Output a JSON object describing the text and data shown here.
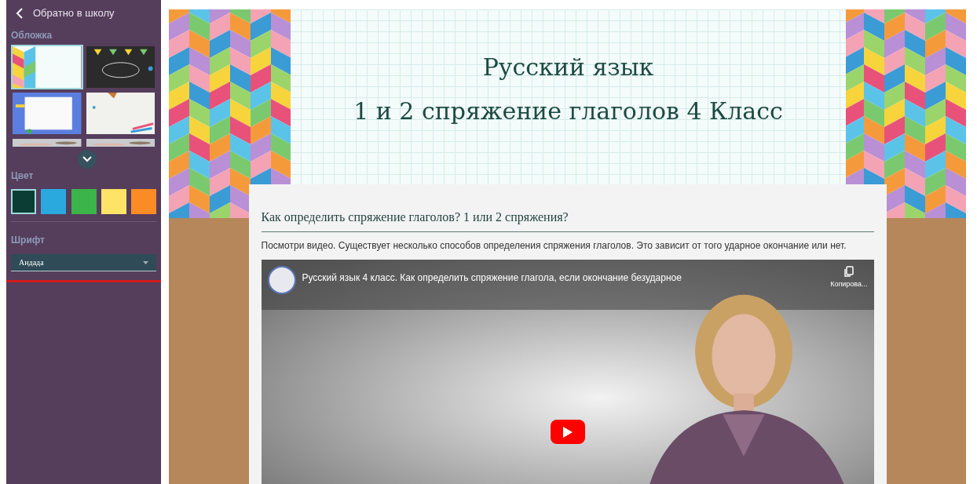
{
  "sidebar": {
    "back_link": "Обратно в школу",
    "cover_section": {
      "title": "Обложка",
      "covers": [
        {
          "selected": true
        },
        {
          "selected": false
        },
        {
          "selected": false
        },
        {
          "selected": false
        },
        {
          "selected": false
        },
        {
          "selected": false
        }
      ]
    },
    "color_section": {
      "title": "Цвет",
      "swatches": [
        {
          "color": "#0b3d35",
          "selected": true
        },
        {
          "color": "#29a9de",
          "selected": false
        },
        {
          "color": "#3bb449",
          "selected": false
        },
        {
          "color": "#fde466",
          "selected": false
        },
        {
          "color": "#fb8b24",
          "selected": false
        }
      ]
    },
    "font_section": {
      "title": "Шрифт",
      "value": "Андада"
    }
  },
  "page": {
    "title_lines": [
      "Русский язык",
      "1 и 2 спряжение глаголов 4 Класс"
    ],
    "card": {
      "heading": "Как определить спряжение глаголов? 1 или 2 спряжения?",
      "text": "Посмотри видео. Существует несколько способов определения спряжения глаголов. Это зависит от того ударное окончание или нет.",
      "video": {
        "title": "Русский язык 4 класс. Как определить спряжение глагола, если окончание безударное",
        "copy_label": "Копирова..."
      }
    }
  }
}
